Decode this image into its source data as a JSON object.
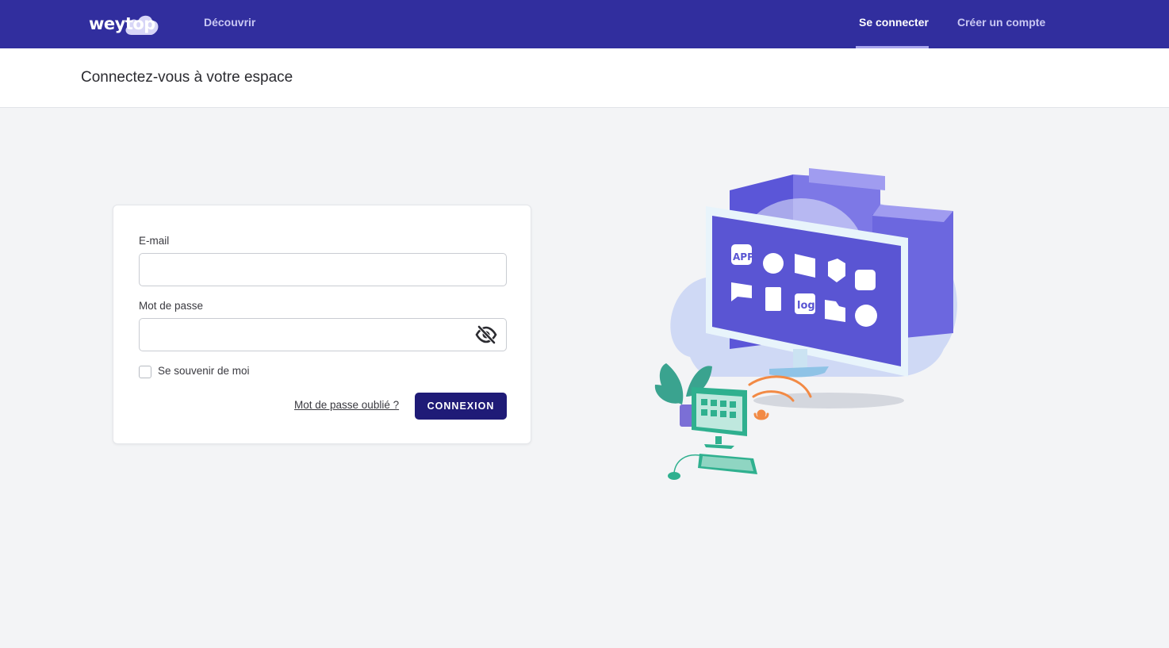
{
  "nav": {
    "logo_text": "weytop",
    "discover": "Découvrir",
    "login": "Se connecter",
    "signup": "Créer un compte"
  },
  "header": {
    "title": "Connectez-vous à votre espace"
  },
  "form": {
    "email_label": "E-mail",
    "email_value": "",
    "password_label": "Mot de passe",
    "password_value": "",
    "remember_label": "Se souvenir de moi",
    "remember_checked": false,
    "forgot_link": "Mot de passe oublié ?",
    "submit_label": "CONNEXION"
  },
  "illustration": {
    "app_icon_text": "APP",
    "log_icon_text": "log"
  },
  "colors": {
    "nav_bg": "#312e9e",
    "button_bg": "#1f1b77",
    "page_bg": "#f3f4f6"
  },
  "icons": [
    "cloud-logo-icon",
    "eye-slash-icon",
    "monitor-illustration"
  ]
}
